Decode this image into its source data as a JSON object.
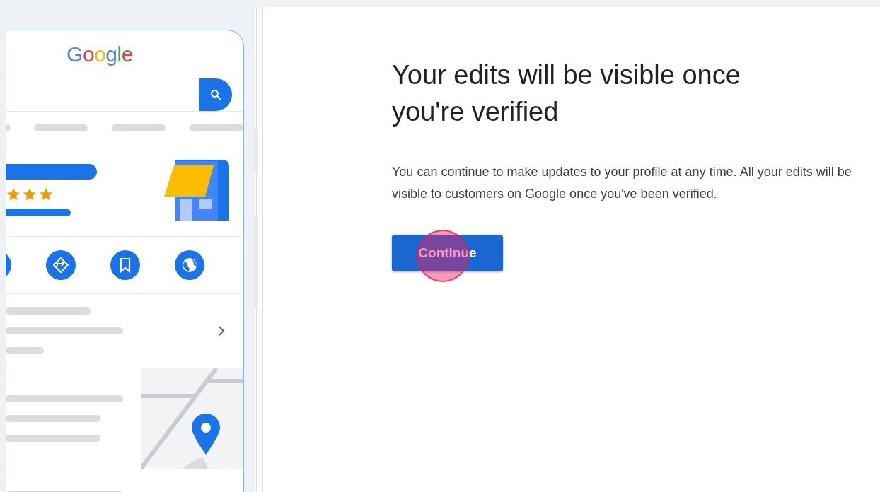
{
  "phone_preview": {
    "logo": "Google",
    "rating": {
      "stars": 3
    }
  },
  "heading": "Your edits will be visible once you're verified",
  "body": "You can continue to make updates to your profile at any time. All your edits will be visible to customers on Google once you've been verified.",
  "continue_button": {
    "label": "Continue"
  }
}
